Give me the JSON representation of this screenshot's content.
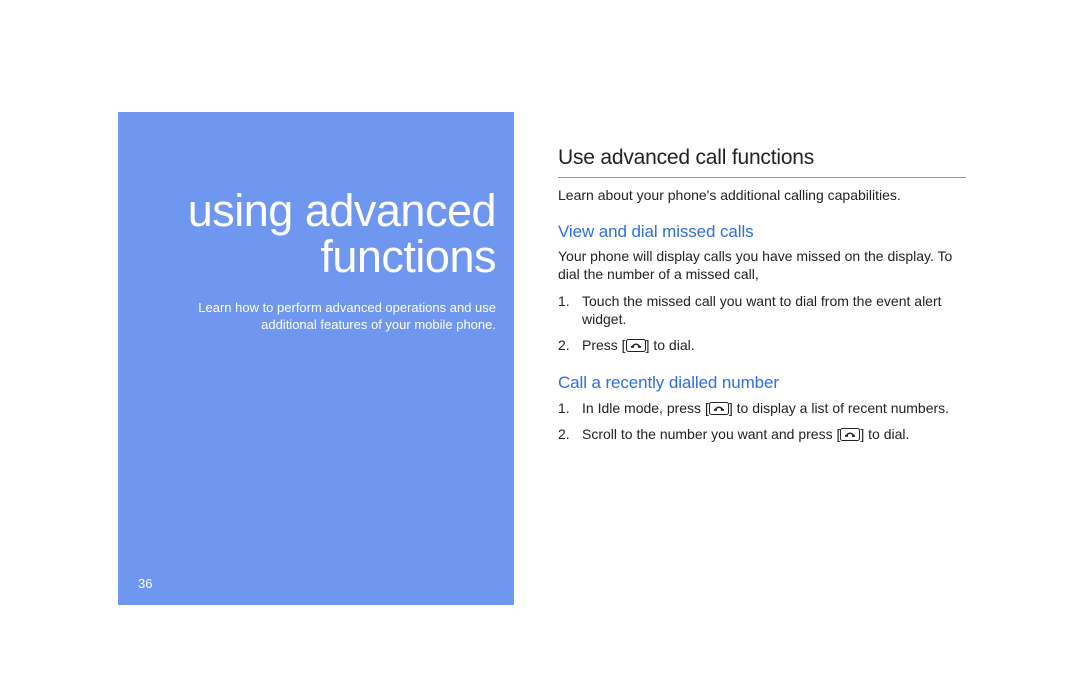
{
  "page_number": "36",
  "left": {
    "title": "using advanced\nfunctions",
    "subtitle": " Learn how to perform advanced operations and use\nadditional features of your mobile phone."
  },
  "right": {
    "heading": "Use advanced call functions",
    "intro": "Learn about your phone's additional calling capabilities.",
    "section1": {
      "heading": "View and dial missed calls",
      "para": "Your phone will display calls you have missed on the display. To dial the number of a missed call,",
      "steps": [
        {
          "full": "Touch the missed call you want to dial from the event alert widget."
        },
        {
          "pre": "Press [",
          "post": "] to dial."
        }
      ]
    },
    "section2": {
      "heading": "Call a recently dialled number",
      "steps": [
        {
          "pre": "In Idle mode, press [",
          "post": "] to display a list of recent numbers."
        },
        {
          "pre": "Scroll to the number you want and press [",
          "post": "] to dial."
        }
      ]
    }
  }
}
